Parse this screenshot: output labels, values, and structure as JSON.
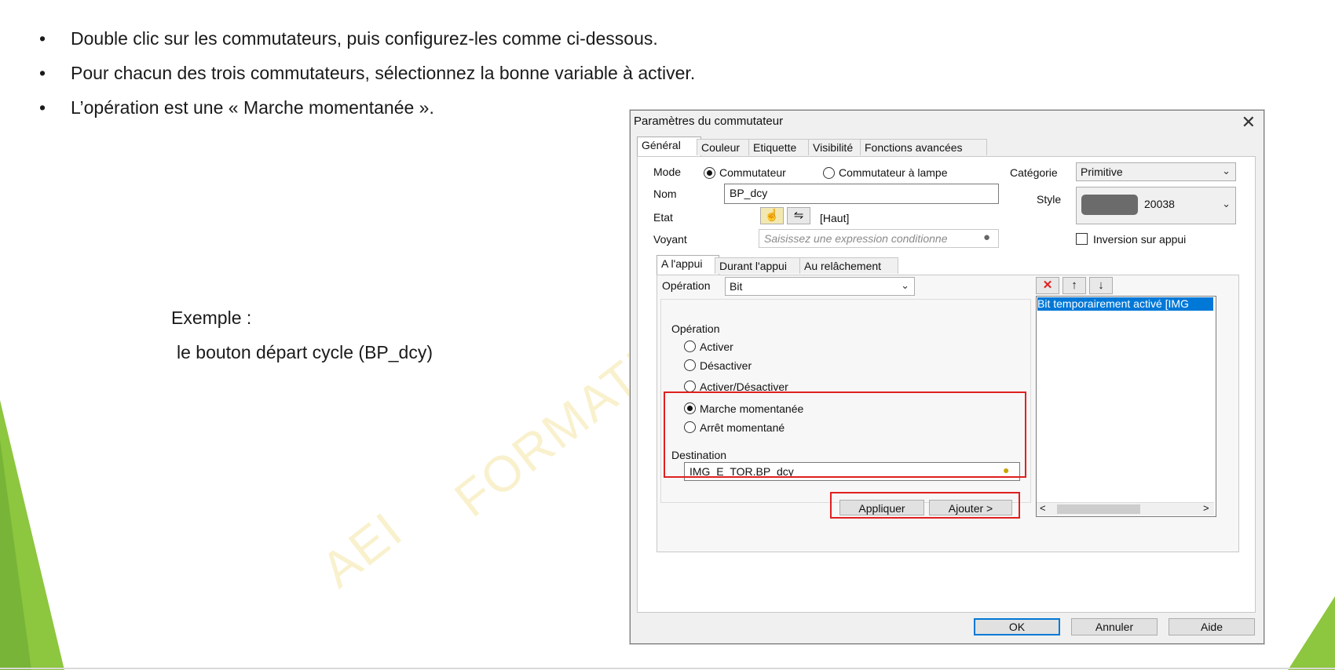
{
  "slide": {
    "bullets": [
      "Double clic sur les commutateurs, puis configurez-les comme ci-dessous.",
      "Pour chacun des trois commutateurs, sélectionnez la bonne variable à activer.",
      "L’opération est une « Marche momentanée »."
    ],
    "bullet_symbol": "•",
    "example_title": "Exemple :",
    "example_text": "le bouton départ cycle (BP_dcy)",
    "watermark_left": "AEI",
    "watermark_right": "FORMATI"
  },
  "dialog": {
    "title": "Paramètres du commutateur",
    "close_symbol": "✕",
    "tabs": [
      "Général",
      "Couleur",
      "Etiquette",
      "Visibilité",
      "Fonctions avancées"
    ],
    "mode_label": "Mode",
    "mode_options": [
      "Commutateur",
      "Commutateur à lampe"
    ],
    "category_label": "Catégorie",
    "category_value": "Primitive",
    "name_label": "Nom",
    "name_value": "BP_dcy",
    "style_label": "Style",
    "style_value": "20038",
    "state_label": "Etat",
    "state_value": "[Haut]",
    "light_label": "Voyant",
    "light_placeholder": "Saisissez une expression conditionne",
    "invert_label": "Inversion sur appui",
    "subtabs": [
      "A l'appui",
      "Durant l'appui",
      "Au relâchement"
    ],
    "operation_select_label": "Opération",
    "operation_select_value": "Bit",
    "operation_group_label": "Opération",
    "operations": [
      "Activer",
      "Désactiver",
      "Activer/Désactiver",
      "Marche momentanée",
      "Arrêt momentané"
    ],
    "selected_operation": "Marche momentanée",
    "destination_label": "Destination",
    "destination_value": "IMG_E_TOR.BP_dcy",
    "apply_label": "Appliquer",
    "add_label": "Ajouter >",
    "list_item": "Bit temporairement activé [IMG",
    "scroll_left": "<",
    "scroll_right": ">",
    "ok_label": "OK",
    "cancel_label": "Annuler",
    "help_label": "Aide",
    "colors": {
      "selection": "#0078d7",
      "highlight_box": "#e0201f",
      "deco_green": "#7ac143"
    }
  }
}
